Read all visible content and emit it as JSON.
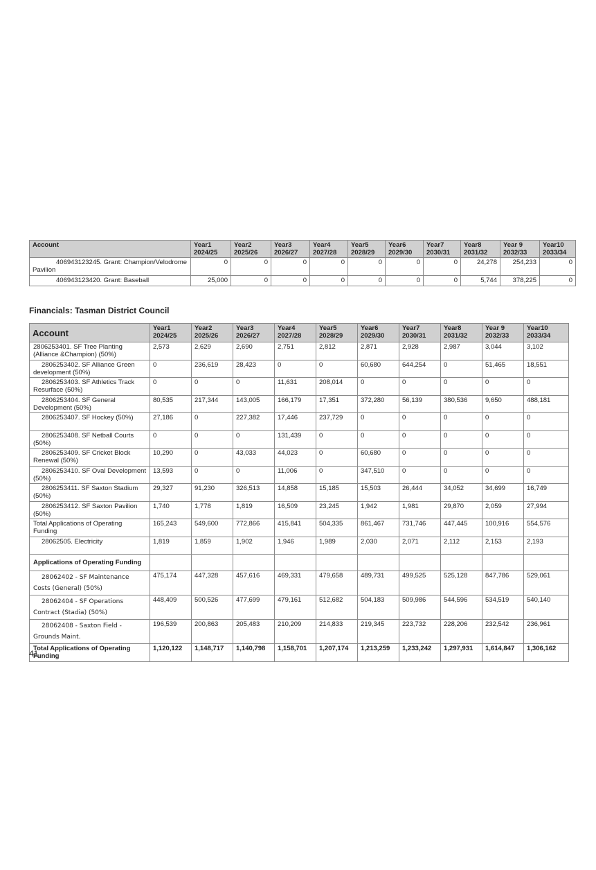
{
  "table1": {
    "headers": [
      "Account",
      "Year1\n2024/25",
      "Year2\n2025/26",
      "Year3\n2026/27",
      "Year4\n2027/28",
      "Year5\n2028/29",
      "Year6\n2029/30",
      "Year7\n2030/31",
      "Year8\n2031/32",
      "Year 9\n2032/33",
      "Year10\n2033/34"
    ],
    "rows": [
      [
        "406943123245. Grant: Champion/Velodrome Pavilion",
        "0",
        "0",
        "0",
        "0",
        "0",
        "0",
        "0",
        "24,278",
        "254,233",
        "0"
      ],
      [
        "406943123420. Grant: Baseball",
        "25,000",
        "0",
        "0",
        "0",
        "0",
        "0",
        "0",
        "5,744",
        "378,225",
        "0"
      ]
    ]
  },
  "heading": "Financials: Tasman District Council",
  "table2": {
    "headers": [
      "Account",
      "Year1\n2024/25",
      "Year2\n2025/26",
      "Year3\n2026/27",
      "Year4\n2027/28",
      "Year5\n2028/29",
      "Year6\n2029/30",
      "Year7\n2030/31",
      "Year8\n2031/32",
      "Year 9\n2032/33",
      "Year10\n2033/34"
    ],
    "rows": [
      [
        "2806253401. SF Tree Planting (Alliance &Champion) (50%)",
        "2,573",
        "2,629",
        "2,690",
        "2,751",
        "2,812",
        "2,871",
        "2,928",
        "2,987",
        "3,044",
        "3,102"
      ],
      [
        "2806253402. SF Alliance Green development (50%)",
        "0",
        "236,619",
        "28,423",
        "0",
        "0",
        "60,680",
        "644,254",
        "0",
        "51,465",
        "18,551"
      ],
      [
        "2806253403. SF Athletics Track Resurface (50%)",
        "0",
        "0",
        "0",
        "11,631",
        "208,014",
        "0",
        "0",
        "0",
        "0",
        "0"
      ],
      [
        "2806253404. SF General Development (50%)",
        "80,535",
        "217,344",
        "143,005",
        "166,179",
        "17,351",
        "372,280",
        "56,139",
        "380,536",
        "9,650",
        "488,181"
      ],
      [
        "2806253407. SF Hockey (50%)",
        "27,186",
        "0",
        "227,382",
        "17,446",
        "237,729",
        "0",
        "0",
        "0",
        "0",
        "0"
      ],
      [
        "2806253408. SF Netball Courts (50%)",
        "0",
        "0",
        "0",
        "131,439",
        "0",
        "0",
        "0",
        "0",
        "0",
        "0"
      ],
      [
        "2806253409. SF Cricket Block Renewal (50%)",
        "10,290",
        "0",
        "43,033",
        "44,023",
        "0",
        "60,680",
        "0",
        "0",
        "0",
        "0"
      ],
      [
        "2806253410. SF Oval Development (50%)",
        "13,593",
        "0",
        "0",
        "11,006",
        "0",
        "347,510",
        "0",
        "0",
        "0",
        "0"
      ],
      [
        "2806253411. SF Saxton Stadium (50%)",
        "29,327",
        "91,230",
        "326,513",
        "14,858",
        "15,185",
        "15,503",
        "26,444",
        "34,052",
        "34,699",
        "16,749"
      ],
      [
        "2806253412. SF Saxton Pavilion (50%)",
        "1,740",
        "1,778",
        "1,819",
        "16,509",
        "23,245",
        "1,942",
        "1,981",
        "29,870",
        "2,059",
        "27,994"
      ],
      [
        "Total Applications of Operating Funding",
        "165,243",
        "549,600",
        "772,866",
        "415,841",
        "504,335",
        "861,467",
        "731,746",
        "447,445",
        "100,916",
        "554,576"
      ],
      [
        "28062505. Electricity",
        "1,819",
        "1,859",
        "1,902",
        "1,946",
        "1,989",
        "2,030",
        "2,071",
        "2,112",
        "2,153",
        "2,193"
      ],
      [
        "Applications of Operating Funding",
        "",
        "",
        "",
        "",
        "",
        "",
        "",
        "",
        "",
        ""
      ],
      [
        "28062402 - SF Maintenance Costs (General) (50%)",
        "475,174",
        "447,328",
        "457,616",
        "469,331",
        "479,658",
        "489,731",
        "499,525",
        "525,128",
        "847,786",
        "529,061"
      ],
      [
        "28062404 - SF Operations Contract (Stadia) (50%)",
        "448,409",
        "500,526",
        "477,699",
        "479,161",
        "512,682",
        "504,183",
        "509,986",
        "544,596",
        "534,519",
        "540,140"
      ],
      [
        "28062408 - Saxton Field - Grounds Maint.",
        "196,539",
        "200,863",
        "205,483",
        "210,209",
        "214,833",
        "219,345",
        "223,732",
        "228,206",
        "232,542",
        "236,961"
      ],
      [
        "Total Applications of Operating Funding",
        "1,120,122",
        "1,148,717",
        "1,140,798",
        "1,158,701",
        "1,207,174",
        "1,213,259",
        "1,233,242",
        "1,297,931",
        "1,614,847",
        "1,306,162"
      ]
    ]
  },
  "page_number": "41"
}
